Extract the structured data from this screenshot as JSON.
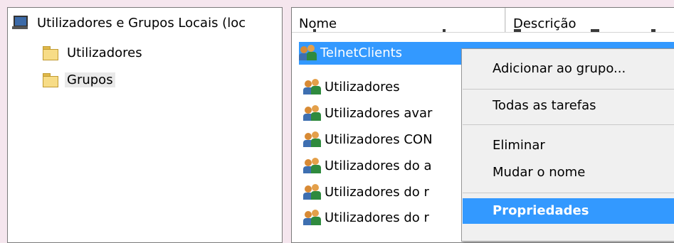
{
  "tree": {
    "root_label": "Utilizadores e Grupos Locais (loc",
    "items": [
      {
        "label": "Utilizadores"
      },
      {
        "label": "Grupos"
      }
    ]
  },
  "list": {
    "columns": [
      "Nome",
      "Descrição"
    ],
    "rows": [
      {
        "name": "TelnetClients",
        "selected": true
      },
      {
        "name": "Utilizadores"
      },
      {
        "name": "Utilizadores avar"
      },
      {
        "name": "Utilizadores CON"
      },
      {
        "name": "Utilizadores do a"
      },
      {
        "name": "Utilizadores do r"
      },
      {
        "name": "Utilizadores do r"
      }
    ]
  },
  "context_menu": {
    "items": [
      {
        "label": "Adicionar ao grupo..."
      },
      {
        "label": "Todas as tarefas",
        "has_submenu": true
      },
      {
        "label": "Eliminar"
      },
      {
        "label": "Mudar o nome"
      },
      {
        "label": "Propriedades",
        "highlighted": true
      }
    ]
  },
  "colors": {
    "background": "#f5e6ee",
    "selection": "#3399ff",
    "menu_background": "#f0f0f0"
  }
}
